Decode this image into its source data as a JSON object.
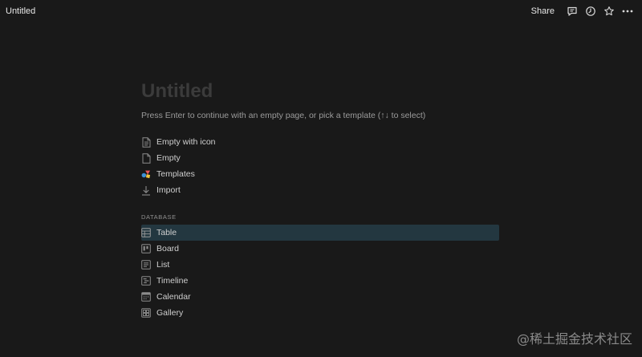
{
  "topbar": {
    "breadcrumb": "Untitled",
    "share_label": "Share",
    "icons": [
      "comment-icon",
      "clock-icon",
      "star-icon",
      "more-icon"
    ]
  },
  "page": {
    "title": "Untitled",
    "hint": "Press Enter to continue with an empty page, or pick a template (↑↓ to select)"
  },
  "options": [
    {
      "label": "Empty with icon",
      "icon": "page-with-icon-icon"
    },
    {
      "label": "Empty",
      "icon": "page-icon"
    },
    {
      "label": "Templates",
      "icon": "templates-icon"
    },
    {
      "label": "Import",
      "icon": "import-icon"
    }
  ],
  "database": {
    "section_label": "DATABASE",
    "items": [
      {
        "label": "Table",
        "icon": "table-icon",
        "selected": true
      },
      {
        "label": "Board",
        "icon": "board-icon",
        "selected": false
      },
      {
        "label": "List",
        "icon": "list-icon",
        "selected": false
      },
      {
        "label": "Timeline",
        "icon": "timeline-icon",
        "selected": false
      },
      {
        "label": "Calendar",
        "icon": "calendar-icon",
        "selected": false
      },
      {
        "label": "Gallery",
        "icon": "gallery-icon",
        "selected": false
      }
    ]
  },
  "watermark": "@稀土掘金技术社区",
  "colors": {
    "background": "#191919",
    "selected_row": "#233740",
    "title_placeholder": "#3b3b3b"
  }
}
